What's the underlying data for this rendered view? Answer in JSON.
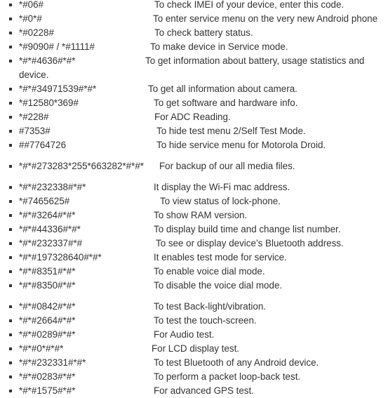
{
  "codes": [
    {
      "code": "*#06#",
      "desc": "To check IMEI of your device, enter this code."
    },
    {
      "code": "*#0*#",
      "desc": "To enter service menu on the very new Android phone"
    },
    {
      "code": "*#0228#",
      "desc": "To check battery status."
    },
    {
      "code": "*#9090# / *#1111#",
      "desc": "To make device in Service mode."
    },
    {
      "code": "*#*#4636#*#*",
      "desc": "To get information about battery, usage statistics and",
      "desc_cont": "device."
    },
    {
      "code": "*#*#34971539#*#*",
      "desc": "To get all information about camera."
    },
    {
      "code": "*#12580*369#",
      "desc": "To get software and hardware info."
    },
    {
      "code": "*#228#",
      "desc": "For ADC Reading."
    },
    {
      "code": "#7353#",
      "desc": "To hide test menu 2/Self Test Mode."
    },
    {
      "code": "##7764726",
      "desc": "To hide service menu for Motorola Droid."
    },
    {
      "code": "*#*#273283*255*663282*#*#*",
      "desc": "For backup of our all media files."
    },
    {
      "code": "*#*#232338#*#*",
      "desc": "It display the Wi-Fi mac address."
    },
    {
      "code": "*#7465625#",
      "desc": "To view status of lock-phone."
    },
    {
      "code": "*#*#3264#*#*",
      "desc": "To show RAM version."
    },
    {
      "code": "*#*#44336#*#*",
      "desc": "To display build time and change list number."
    },
    {
      "code": "*#*#232337#*#",
      "desc": "To see or display device’s Bluetooth address."
    },
    {
      "code": "*#*#197328640#*#*",
      "desc": "It enables test mode for service."
    },
    {
      "code": "*#*#8351#*#*",
      "desc": "To enable voice dial mode."
    },
    {
      "code": "*#*#8350#*#*",
      "desc": "To disable the voice dial mode."
    },
    {
      "code": "*#*#0842#*#*",
      "desc": "To test Back-light/vibration."
    },
    {
      "code": "*#*#2664#*#*",
      "desc": "To test the touch-screen."
    },
    {
      "code": "*#*#0289#*#*",
      "desc": "For Audio test."
    },
    {
      "code": "*#*#0*#*#*",
      "desc": "For LCD display test."
    },
    {
      "code": "*#*#232331#*#*",
      "desc": "To test Bluetooth of any Android device."
    },
    {
      "code": "*#*#0283#*#*",
      "desc": "To perform a packet loop-back test."
    },
    {
      "code": "*#*#1575#*#*",
      "desc": "For advanced GPS test."
    }
  ]
}
